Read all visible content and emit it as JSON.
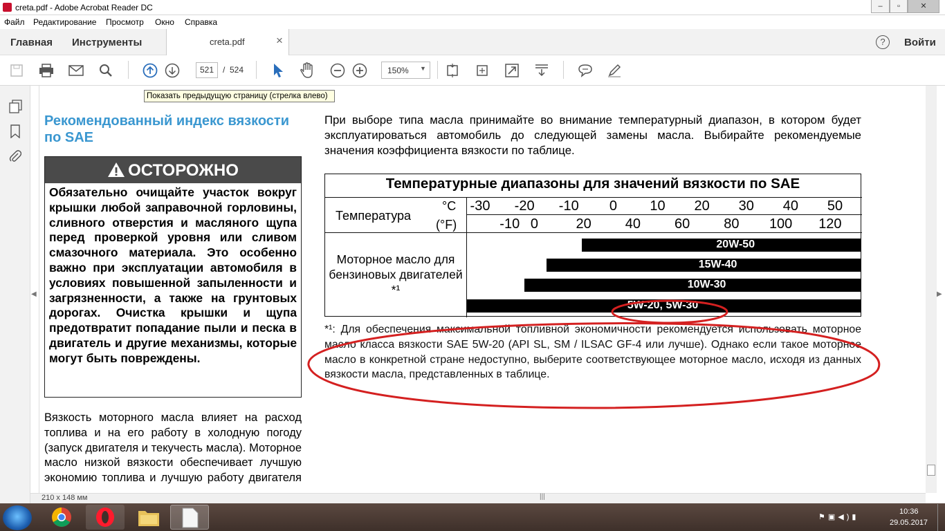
{
  "window": {
    "title": "creta.pdf - Adobe Acrobat Reader DC",
    "minimize": "–",
    "maximize": "▫",
    "close": "✕"
  },
  "menu": [
    "Файл",
    "Редактирование",
    "Просмотр",
    "Окно",
    "Справка"
  ],
  "tabs": {
    "home": "Главная",
    "tools": "Инструменты",
    "doc": "creta.pdf",
    "doc_close": "×",
    "help": "?",
    "signin": "Войти"
  },
  "toolbar": {
    "page_current": "521",
    "page_sep": "/",
    "page_total": "524",
    "zoom": "150%",
    "tooltip": "Показать предыдущую страницу (стрелка влево)"
  },
  "status": {
    "page_size": "210 x 148 мм"
  },
  "doc": {
    "heading": "Рекомендованный индекс вяз­кости по SAE",
    "warning_title": "ОСТОРОЖНО",
    "warning_text": "Обязательно очищайте участок вокруг крышки любой заправочной горловины, сливного отверстия и масляного щупа перед проверкой уровня или сливом смазочного материала. Это особенно важно при эксплуатации автомобиля в усло­виях повышенной запыленности и загрязненности, а также на грун­товых дорогах. Очистка крышки и щупа предотвратит попадание пыли и песка в двигатель и другие меха­низмы, которые могут быть повреж­дены.",
    "body": "Вязкость моторного масла влияет на расход топлива и на его работу в холод­ную погоду (запуск двигателя и текучесть масла). Моторное масло низкой вяз­кости обеспечивает лучшую экономию топлива и лучшую работу двигателя в",
    "intro": "При выборе типа масла принимайте во внимание температурный диапазон, в кото­ром будет эксплуатироваться автомобиль до следующей замены масла. Выбирайте рекомендуемые значения коэффициента вязкости по таблице.",
    "table_title": "Температурные диапазоны для значений вязкости по SAE",
    "temp_label": "Температура",
    "unit_c": "°C",
    "unit_f": "(°F)",
    "celsius": [
      "-30",
      "-20",
      "-10",
      "0",
      "10",
      "20",
      "30",
      "40",
      "50"
    ],
    "fahrenheit": [
      "-10",
      "0",
      "20",
      "40",
      "60",
      "80",
      "100",
      "120"
    ],
    "oil_label": "Моторное масло для бензиновых двигате­лей *¹",
    "grades": [
      {
        "label": "20W-50",
        "min_c": -7,
        "max_c": 50
      },
      {
        "label": "15W-40",
        "min_c": -15,
        "max_c": 50
      },
      {
        "label": "10W-30",
        "min_c": -20,
        "max_c": 50
      },
      {
        "label": "5W-20, 5W-30",
        "min_c": -30,
        "max_c": 50
      }
    ],
    "footnote": "*¹: Для обеспечения максимальной топливной экономичности рекомендуется использовать моторное масло класса вязкости SAE 5W-20 (API SL, SM / ILSAC GF-4 или лучше). Однако если такое моторное масло в конкретной стране недоступно, выберите соответствующее моторное масло, исходя из данных вязкости масла, представленных в таблице."
  },
  "taskbar": {
    "clock_time": "10:36",
    "clock_date": "29.05.2017"
  },
  "colors": {
    "heading": "#3a97d0",
    "annotation": "#d42020",
    "accent_blue": "#2a6ebb"
  }
}
